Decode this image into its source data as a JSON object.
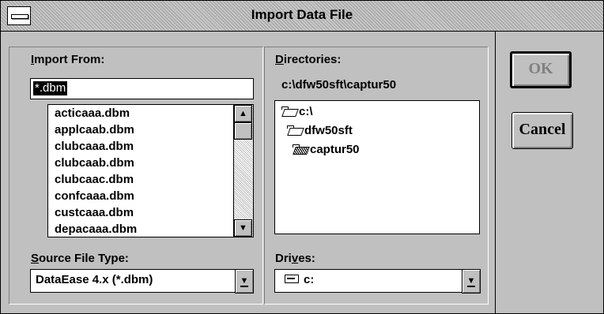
{
  "window": {
    "title": "Import Data File"
  },
  "import_from": {
    "label_mnemonic": "I",
    "label_rest": "mport From:",
    "filename_value": "*.dbm",
    "files": [
      "acticaaa.dbm",
      "applcaab.dbm",
      "clubcaaa.dbm",
      "clubcaab.dbm",
      "clubcaac.dbm",
      "confcaaa.dbm",
      "custcaaa.dbm",
      "depacaaa.dbm"
    ]
  },
  "source_type": {
    "label_mnemonic": "S",
    "label_rest": "ource File Type:",
    "value": "DataEase 4.x (*.dbm)"
  },
  "directories": {
    "label_mnemonic": "D",
    "label_rest": "irectories:",
    "current_path": "c:\\dfw50sft\\captur50",
    "tree": [
      "c:\\",
      "dfw50sft",
      "captur50"
    ]
  },
  "drives": {
    "label_pre": "Dri",
    "label_mnemonic": "v",
    "label_post": "es:",
    "value": "c:"
  },
  "buttons": {
    "ok": "OK",
    "cancel": "Cancel"
  },
  "icons": {
    "scroll_up": "▲",
    "scroll_down": "▼"
  }
}
